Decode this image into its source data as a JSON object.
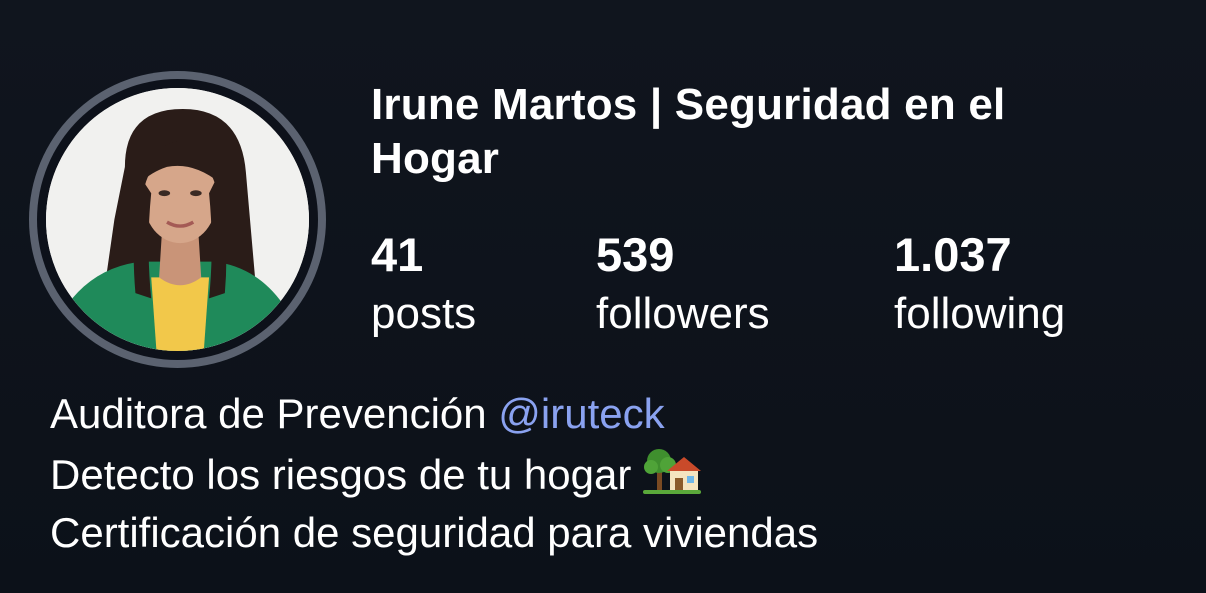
{
  "profile": {
    "name": "Irune Martos | Seguridad en el Hogar",
    "avatar_icon": "profile-photo",
    "ring_color": "#5b6270",
    "stats": [
      {
        "count": "41",
        "label": "posts"
      },
      {
        "count": "539",
        "label": "followers"
      },
      {
        "count": "1.037",
        "label": "following"
      }
    ],
    "bio": {
      "line1_text": "Auditora de Prevención ",
      "line1_mention": "@iruteck",
      "line2_text": "Detecto los riesgos de tu hogar",
      "line2_emoji": "house-with-garden-icon",
      "line3_text": "Certificación de seguridad para viviendas"
    },
    "mention_color": "#8aa2f0"
  }
}
